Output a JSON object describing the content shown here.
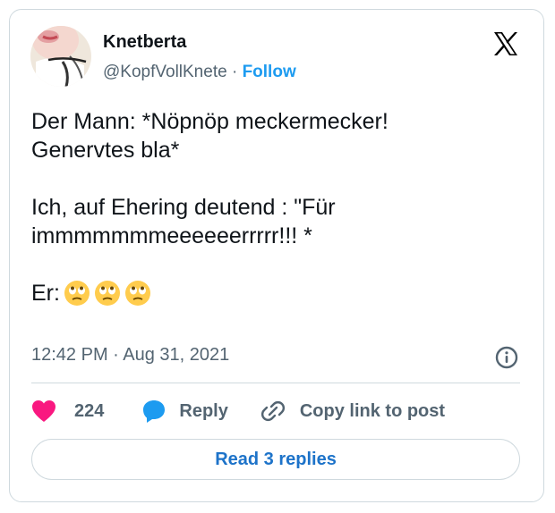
{
  "author": {
    "name": "Knetberta",
    "handle": "@KopfVollKnete",
    "separator": "·",
    "follow_label": "Follow"
  },
  "brand": {
    "icon": "x-logo-icon",
    "color": "#000000"
  },
  "tweet": {
    "line1": "Der Mann: *Nöpnöp meckermecker!",
    "line2": "Genervtes bla*",
    "line3": "Ich, auf Ehering deutend : \"Für",
    "line4": "immmmmmmeeeeeerrrrr!!! *",
    "line5_prefix": "Er:",
    "emojis": [
      "face-with-rolling-eyes",
      "face-with-rolling-eyes",
      "face-with-rolling-eyes"
    ]
  },
  "meta": {
    "timestamp": "12:42 PM · Aug 31, 2021",
    "info_icon": "info-icon"
  },
  "actions": {
    "like_count": "224",
    "reply_label": "Reply",
    "copy_label": "Copy link to post"
  },
  "footer": {
    "read_replies_label": "Read 3 replies"
  },
  "colors": {
    "accent": "#1d9bf0",
    "like": "#f91880",
    "muted": "#536471",
    "text": "#0f1419",
    "border": "#cfd9de"
  }
}
